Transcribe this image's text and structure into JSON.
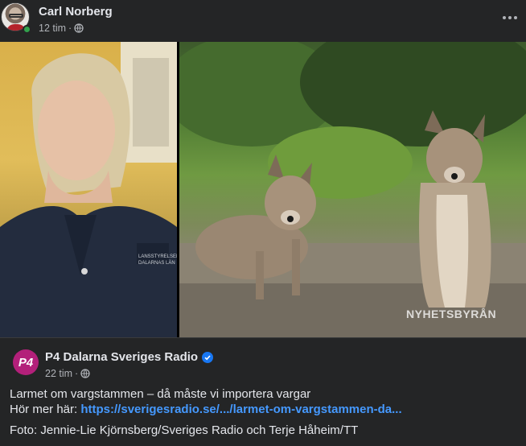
{
  "post": {
    "author_name": "Carl Norberg",
    "time": "12 tim",
    "separator": "·",
    "privacy_icon": "globe-icon",
    "more_icon": "more-horizontal-icon"
  },
  "photos": {
    "left_label_1": "LANSSTYRELSEN",
    "left_label_2": "DALARNAS LÄN",
    "watermark": "NYHETSBYRÅN"
  },
  "shared": {
    "page_name": "P4 Dalarna Sveriges Radio",
    "logo_text": "P4",
    "verified_icon": "verified-badge-icon",
    "time": "22 tim",
    "separator": "·",
    "line1": "Larmet om vargstammen – då måste vi importera vargar",
    "line2_prefix": "Hör mer här: ",
    "link": "https://sverigesradio.se/.../larmet-om-vargstammen-da...",
    "credit": "Foto: Jennie-Lie Kjörnsberg/Sveriges Radio och Terje Håheim/TT"
  },
  "colors": {
    "background": "#242526",
    "link": "#4599ff",
    "online": "#31a24c",
    "verified": "#1877f2",
    "p4_brand": "#b3207a"
  }
}
